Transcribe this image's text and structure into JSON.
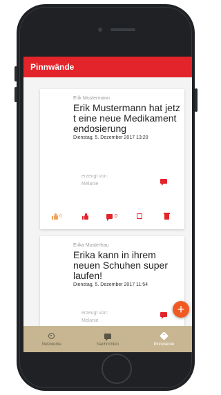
{
  "app": {
    "title": "Pinnwände"
  },
  "posts": [
    {
      "author": "Erik Mustermann",
      "text": "Erik Mustermann hat jetzt eine neue Medikamentendosierung",
      "date": "Dienstag, 5. Dezember 2017 13:20",
      "created_by_label": "erzeugt von:",
      "created_by": "Melanie",
      "like_count": "0",
      "comment_count": "0"
    },
    {
      "author": "Erika Musterfrau",
      "text": "Erika kann in ihrem neuen Schuhen super laufen!",
      "date": "Dienstag, 5. Dezember 2017 11:54",
      "created_by_label": "erzeugt von:",
      "created_by": "Melanie"
    }
  ],
  "fab": {
    "label": "+"
  },
  "bottom_nav": [
    {
      "label": "Netzwerke",
      "icon": "network-icon"
    },
    {
      "label": "Nachrichten",
      "icon": "messages-icon"
    },
    {
      "label": "Pinnwände",
      "icon": "tag-icon",
      "active": true
    }
  ],
  "colors": {
    "primary": "#e3242a",
    "fab": "#f05a22",
    "bottom_nav_bg": "#c7b691",
    "faded_like": "#f1a35a"
  }
}
